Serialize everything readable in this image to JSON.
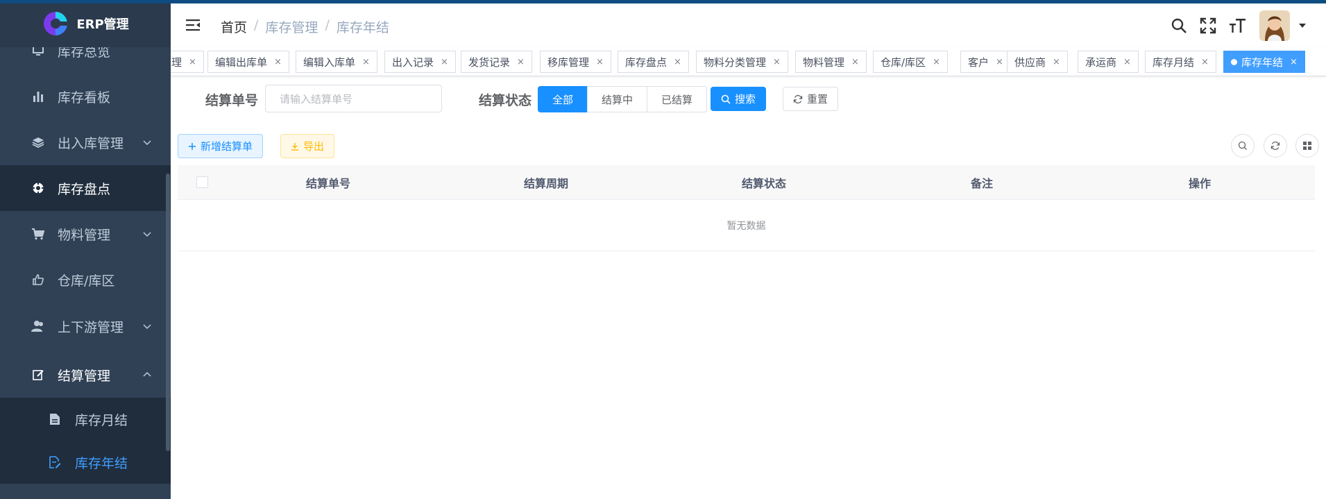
{
  "app": {
    "title": "ERP管理"
  },
  "sidebar": {
    "items": [
      {
        "label": "库存总览",
        "icon": "monitor-icon"
      },
      {
        "label": "库存看板",
        "icon": "bar-chart-icon"
      },
      {
        "label": "出入库管理",
        "icon": "layers-icon",
        "expandable": true
      },
      {
        "label": "库存盘点",
        "icon": "compass-icon",
        "active": true
      },
      {
        "label": "物料管理",
        "icon": "cart-icon",
        "expandable": true
      },
      {
        "label": "仓库/库区",
        "icon": "thumb-icon"
      },
      {
        "label": "上下游管理",
        "icon": "users-icon",
        "expandable": true
      },
      {
        "label": "结算管理",
        "icon": "edit-icon",
        "expanded": true
      }
    ],
    "subitems": [
      {
        "label": "库存月结",
        "icon": "document-icon"
      },
      {
        "label": "库存年结",
        "icon": "document-edit-icon",
        "current": true
      }
    ]
  },
  "header": {
    "breadcrumb": [
      "首页",
      "库存管理",
      "库存年结"
    ],
    "separator": "/"
  },
  "tags": [
    {
      "label": "理"
    },
    {
      "label": "编辑出库单"
    },
    {
      "label": "编辑入库单"
    },
    {
      "label": "出入记录"
    },
    {
      "label": "发货记录"
    },
    {
      "label": "移库管理"
    },
    {
      "label": "库存盘点"
    },
    {
      "label": "物料分类管理"
    },
    {
      "label": "物料管理"
    },
    {
      "label": "仓库/库区"
    },
    {
      "label": "客户"
    },
    {
      "label": "供应商"
    },
    {
      "label": "承运商"
    },
    {
      "label": "库存月结"
    },
    {
      "label": "库存年结",
      "active": true
    }
  ],
  "tag_close": "×",
  "search": {
    "no_label": "结算单号",
    "no_placeholder": "请输入结算单号",
    "status_label": "结算状态",
    "status_options": [
      "全部",
      "结算中",
      "已结算"
    ],
    "status_selected": "全部",
    "search_button": "搜索",
    "reset_button": "重置"
  },
  "toolbar": {
    "add_button": "新增结算单",
    "export_button": "导出"
  },
  "table": {
    "columns": [
      "结算单号",
      "结算周期",
      "结算状态",
      "备注",
      "操作"
    ],
    "empty_text": "暂无数据"
  },
  "colors": {
    "sidebar_bg": "#304156",
    "primary": "#1890ff",
    "active_link": "#409eff"
  }
}
